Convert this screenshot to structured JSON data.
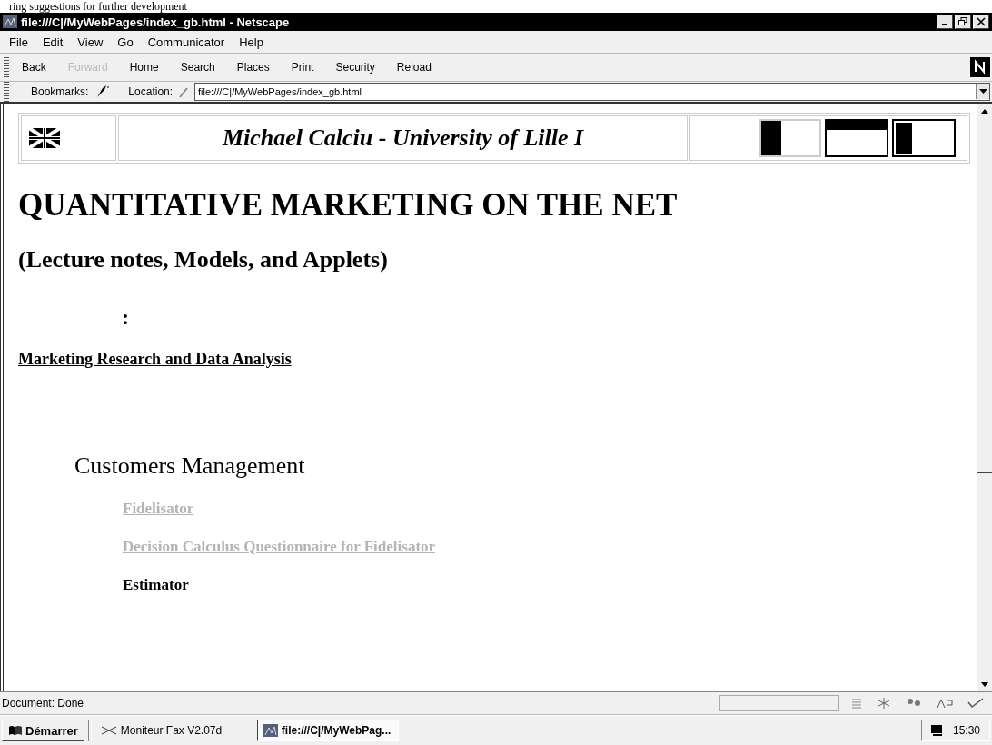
{
  "top_strip": {
    "text": "ring suggestions for further development"
  },
  "window": {
    "title": "file:///C|/MyWebPages/index_gb.html - Netscape"
  },
  "menu": [
    "File",
    "Edit",
    "View",
    "Go",
    "Communicator",
    "Help"
  ],
  "toolbar": [
    {
      "label": "Back",
      "disabled": false
    },
    {
      "label": "Forward",
      "disabled": true
    },
    {
      "label": "Home",
      "disabled": false
    },
    {
      "label": "Search",
      "disabled": false
    },
    {
      "label": "Places",
      "disabled": false
    },
    {
      "label": "Print",
      "disabled": false
    },
    {
      "label": "Security",
      "disabled": false
    },
    {
      "label": "Reload",
      "disabled": false
    }
  ],
  "location_bar": {
    "bookmarks": "Bookmarks:",
    "location_label": "Location:",
    "url": "file:///C|/MyWebPages/index_gb.html"
  },
  "page": {
    "banner_title": "Michael Calciu - University of Lille I",
    "heading": "QUANTITATIVE MARKETING ON THE NET",
    "subheading": "(Lecture notes, Models, and Applets)",
    "colon": ":",
    "section_link": "Marketing Research and Data Analysis",
    "section_title": "Customers Management",
    "links": [
      {
        "text": "Fidelisator ",
        "visited": true
      },
      {
        "text": "Decision Calculus Questionnaire for Fidelisator",
        "visited": true
      },
      {
        "text": "Estimator",
        "visited": false
      }
    ]
  },
  "status_bar": {
    "text": "Document: Done"
  },
  "taskbar": {
    "start": "Démarrer",
    "tasks": [
      {
        "label": "Moniteur Fax V2.07d",
        "selected": false
      },
      {
        "label": "file:///C|/MyWebPag...",
        "selected": true
      }
    ],
    "clock": "15:30"
  }
}
